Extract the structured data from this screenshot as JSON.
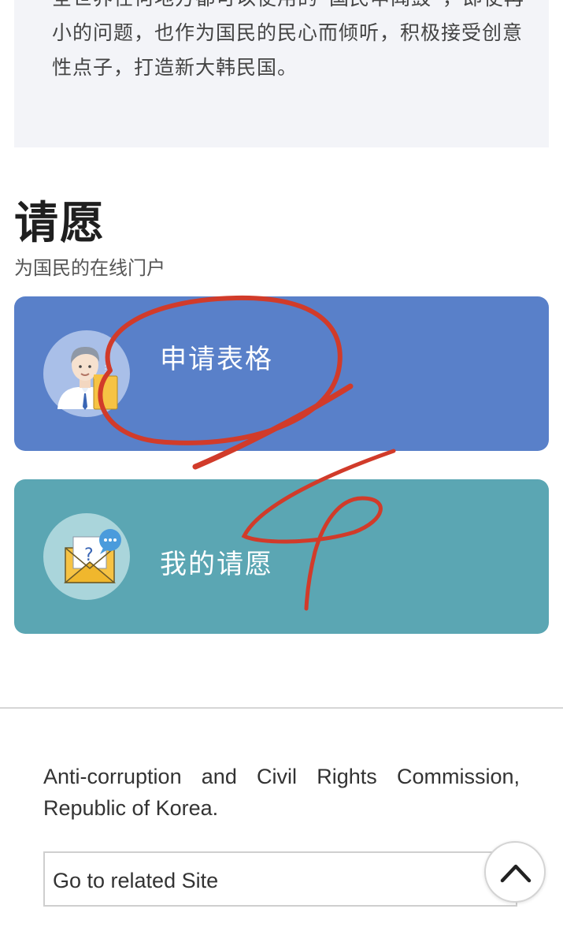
{
  "intro": {
    "text": "全世界任何地方都可以使用的“国民申闻鼓”，即使再小的问题，也作为国民的民心而倾听，积极接受创意性点子，打造新大韩民国。"
  },
  "petition_section": {
    "title": "请愿",
    "subtitle": "为国民的在线门户"
  },
  "cards": [
    {
      "label": "申请表格",
      "icon": "applicant-form-icon",
      "color": "#5980c9"
    },
    {
      "label": "我的请愿",
      "icon": "mail-question-icon",
      "color": "#5ba6b3"
    }
  ],
  "footer": {
    "organization": "Anti-corruption and Civil Rights Commission, Republic of Korea.",
    "related_site_label": "Go to related Site",
    "scroll_top_icon": "chevron-up-icon"
  },
  "annotation_color": "#d13b2a"
}
